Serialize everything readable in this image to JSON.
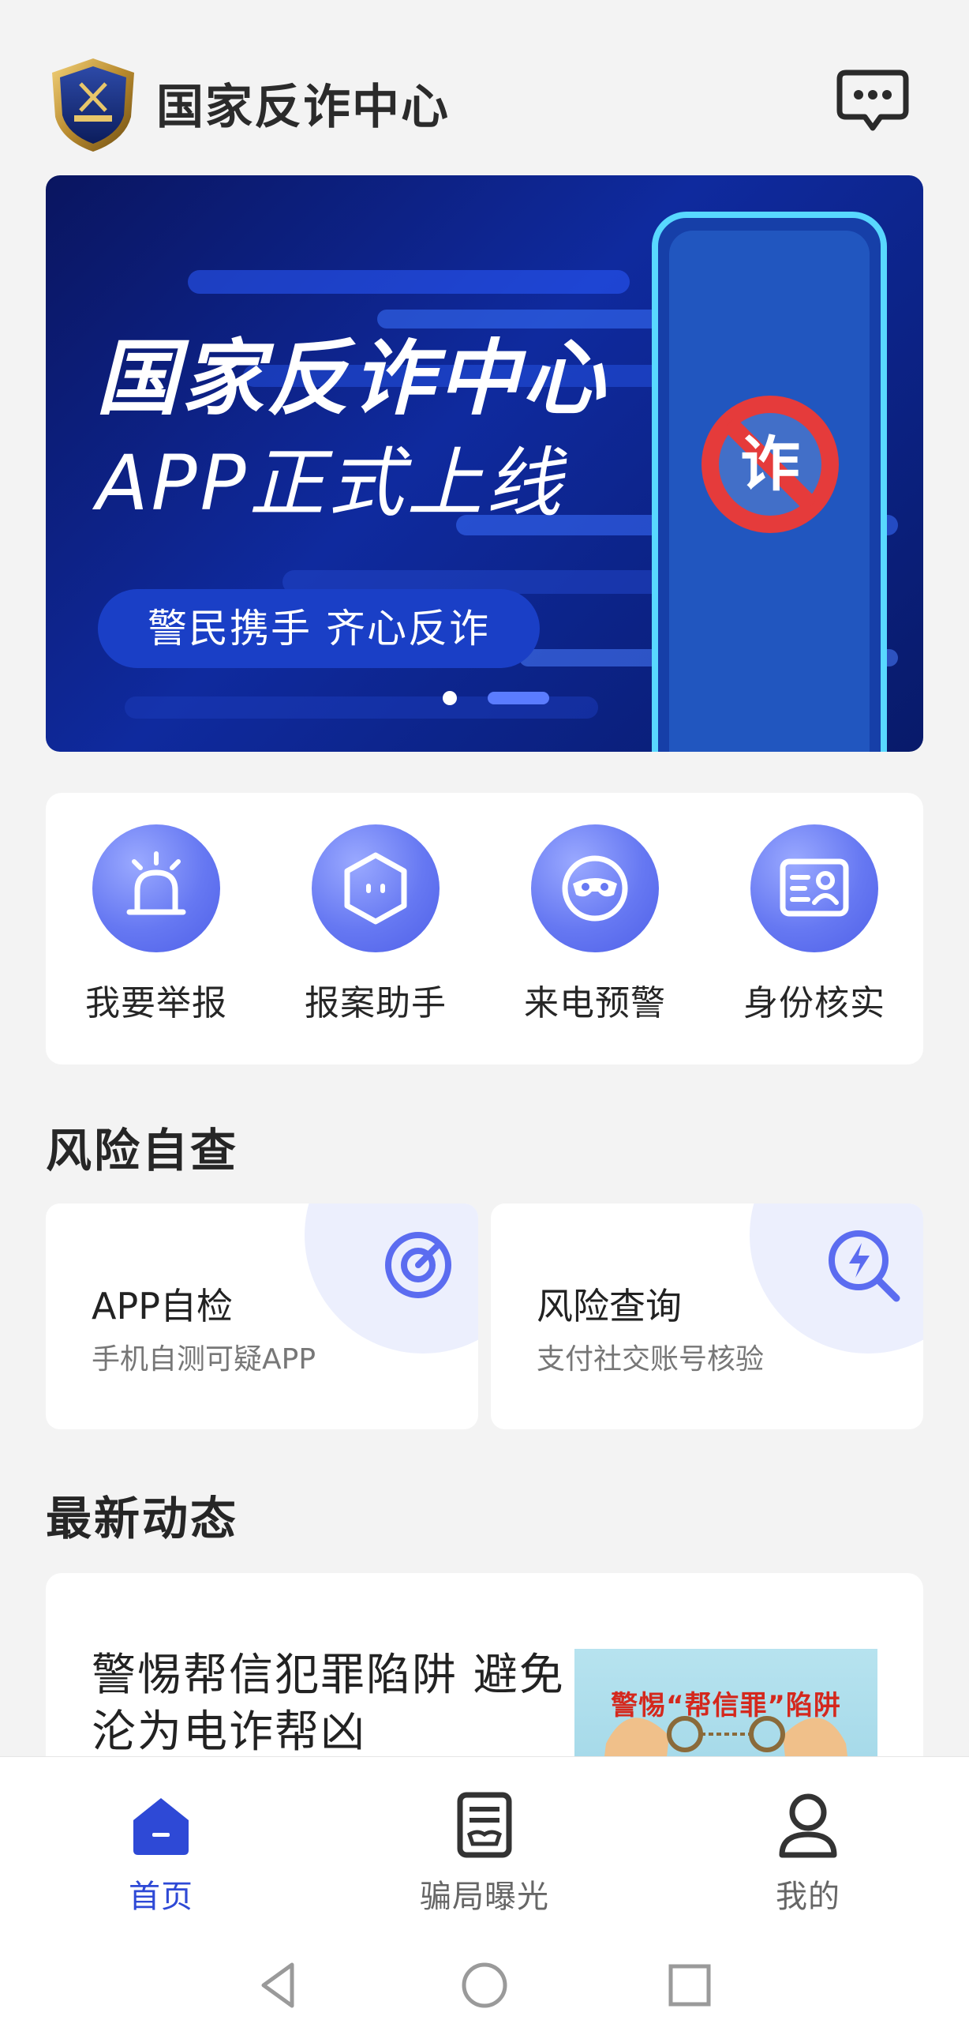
{
  "header": {
    "title": "国家反诈中心",
    "logo_icon": "shield-badge-icon",
    "message_icon": "chat-bubble-icon"
  },
  "banner": {
    "title": "国家反诈中心",
    "subtitle": "APP正式上线",
    "pill_text": "警民携手   齐心反诈",
    "badge_char": "诈",
    "active_slide": 2,
    "slide_count": 2
  },
  "quick_actions": [
    {
      "label": "我要举报",
      "icon": "alarm-light-icon"
    },
    {
      "label": "报案助手",
      "icon": "robot-hexagon-icon"
    },
    {
      "label": "来电预警",
      "icon": "mask-icon"
    },
    {
      "label": "身份核实",
      "icon": "id-card-icon"
    }
  ],
  "risk_check": {
    "title": "风险自查",
    "items": [
      {
        "title": "APP自检",
        "subtitle": "手机自测可疑APP",
        "icon": "target-scan-icon"
      },
      {
        "title": "风险查询",
        "subtitle": "支付社交账号核验",
        "icon": "lightning-search-icon"
      }
    ]
  },
  "news": {
    "title": "最新动态",
    "items": [
      {
        "title": "警惕帮信犯罪陷阱  避免沦为电诈帮凶",
        "thumb_caption": "警惕“帮信罪”陷阱"
      }
    ]
  },
  "bottom_nav": [
    {
      "label": "首页",
      "icon": "home-icon",
      "active": true
    },
    {
      "label": "骗局曝光",
      "icon": "news-doc-icon",
      "active": false
    },
    {
      "label": "我的",
      "icon": "user-icon",
      "active": false
    }
  ],
  "system_nav": {
    "back_icon": "back-triangle-icon",
    "home_icon": "home-circle-icon",
    "recents_icon": "recents-square-icon"
  },
  "colors": {
    "accent": "#2e49d6",
    "icon_gradient_start": "#9aa9ff",
    "icon_gradient_end": "#4f60e8",
    "banner_bg": "#0f2a9e",
    "page_bg": "#f3f3f3"
  }
}
